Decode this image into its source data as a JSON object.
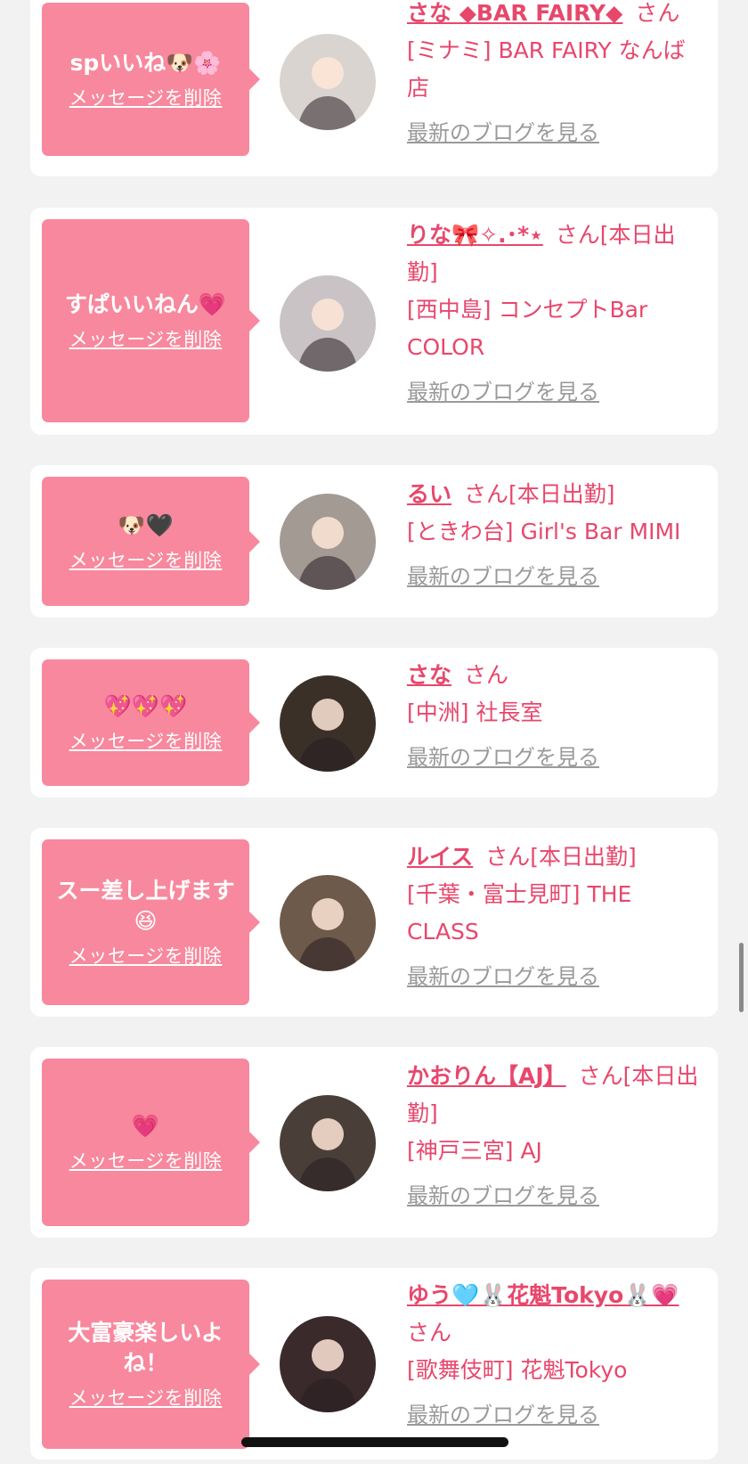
{
  "items": [
    {
      "message": "spいいね🐶🌸",
      "delete_label": "メッセージを削除",
      "name": "さな ◆BAR FAIRY◆",
      "suffix": "さん",
      "shop": "[ミナミ] BAR FAIRY なんば店",
      "blog_label": "最新のブログを見る",
      "avatar_color": "#d9d4d0"
    },
    {
      "message": "すぱいいねん💗",
      "delete_label": "メッセージを削除",
      "name": "りな🎀✧.･*⋆",
      "suffix": "さん[本日出勤]",
      "shop": "[西中島] コンセプトBar COLOR",
      "blog_label": "最新のブログを見る",
      "avatar_color": "#c9c3c6"
    },
    {
      "message": "🐶🖤",
      "delete_label": "メッセージを削除",
      "name": "るい",
      "suffix": "さん[本日出勤]",
      "shop": "[ときわ台] Girl's Bar MIMI",
      "blog_label": "最新のブログを見る",
      "avatar_color": "#a39a94"
    },
    {
      "message": "💖💖💖",
      "delete_label": "メッセージを削除",
      "name": "さな",
      "suffix": "さん",
      "shop": "[中洲] 社長室",
      "blog_label": "最新のブログを見る",
      "avatar_color": "#3b3028"
    },
    {
      "message": "スー差し上げます😆",
      "delete_label": "メッセージを削除",
      "name": "ルイス",
      "suffix": "さん[本日出勤]",
      "shop": "[千葉・富士見町] THE CLASS",
      "blog_label": "最新のブログを見る",
      "avatar_color": "#6e5a4a"
    },
    {
      "message": "💗",
      "delete_label": "メッセージを削除",
      "name": "かおりん【AJ】",
      "suffix": "さん[本日出勤]",
      "shop": "[神戸三宮] AJ",
      "blog_label": "最新のブログを見る",
      "avatar_color": "#4a3f38"
    },
    {
      "message": "大富豪楽しいよね！",
      "delete_label": "メッセージを削除",
      "name": "ゆう🩵🐰花魁Tokyo🐰💗",
      "suffix": "さん",
      "shop": "[歌舞伎町] 花魁Tokyo",
      "blog_label": "最新のブログを見る",
      "avatar_color": "#3a2a2c"
    }
  ],
  "colors": {
    "bubble": "#f8889d",
    "accent": "#e8476c",
    "link_gray": "#9a9a9a",
    "background": "#f2f2f2"
  }
}
